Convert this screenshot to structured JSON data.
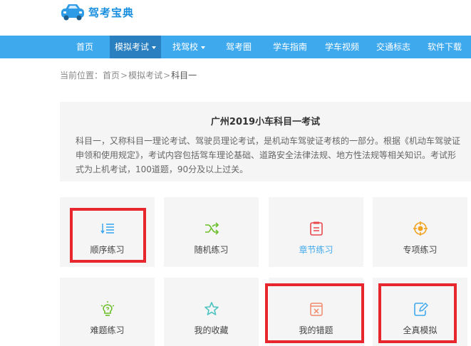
{
  "logo": {
    "text": "驾考宝典"
  },
  "nav": {
    "items": [
      {
        "label": "首页",
        "active": false,
        "dropdown": false
      },
      {
        "label": "模拟考试",
        "active": true,
        "dropdown": true
      },
      {
        "label": "找驾校",
        "active": false,
        "dropdown": true
      },
      {
        "label": "驾考圈",
        "active": false,
        "dropdown": false
      },
      {
        "label": "学车指南",
        "active": false,
        "dropdown": false
      },
      {
        "label": "学车视频",
        "active": false,
        "dropdown": false
      },
      {
        "label": "交通标志",
        "active": false,
        "dropdown": false
      },
      {
        "label": "软件下载",
        "active": false,
        "dropdown": false
      }
    ]
  },
  "breadcrumb": {
    "prefix": "当前位置：",
    "items": [
      "首页",
      "模拟考试",
      "科目一"
    ],
    "separator": ">"
  },
  "intro": {
    "title": "广州2019小车科目一考试",
    "text": "科目一，又称科目一理论考试、驾驶员理论考试，是机动车驾驶证考核的一部分。根据《机动车驾驶证申领和使用规定》，考试内容包括驾车理论基础、道路安全法律法规、地方性法规等相关知识。考试形式为上机考试，100道题，90分及以上过关。"
  },
  "cards": [
    {
      "label": "顺序练习",
      "icon": "list-order-icon",
      "color": "#3fa9ee"
    },
    {
      "label": "随机练习",
      "icon": "shuffle-icon",
      "color": "#6bbf2a"
    },
    {
      "label": "章节练习",
      "icon": "chapter-icon",
      "color": "#e8474c"
    },
    {
      "label": "专项练习",
      "icon": "target-icon",
      "color": "#f3a21e"
    },
    {
      "label": "难题练习",
      "icon": "lightbulb-icon",
      "color": "#6bbf2a"
    },
    {
      "label": "我的收藏",
      "icon": "star-icon",
      "color": "#4cc3c0"
    },
    {
      "label": "我的错题",
      "icon": "wrong-book-icon",
      "color": "#f08a6a"
    },
    {
      "label": "全真模拟",
      "icon": "edit-doc-icon",
      "color": "#3fa9ee"
    }
  ],
  "colors": {
    "nav_bg": "#3fa9ee",
    "nav_active": "#2a7fc0",
    "highlight": "#e8262d"
  }
}
